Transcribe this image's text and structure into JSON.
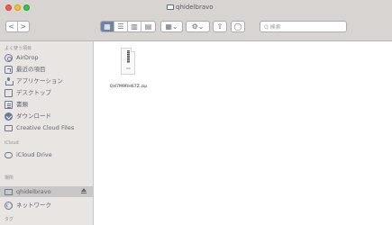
{
  "window": {
    "title": "qhidelbravo"
  },
  "toolbar": {
    "back": "<",
    "forward": ">",
    "view_icon": "▦",
    "list_icon": "☰",
    "column_icon": "▥",
    "gallery_icon": "▤",
    "arrange_icon": "▦",
    "action_icon": "⚙",
    "share_icon": "⇧",
    "tag_icon": "◯",
    "search_placeholder": "Q 検索"
  },
  "sidebar": {
    "favorites_label": "よく使う項目",
    "items": [
      {
        "label": "AirDrop",
        "icon": "airdrop-icon"
      },
      {
        "label": "最近の項目",
        "icon": "recent-icon"
      },
      {
        "label": "アプリケーション",
        "icon": "applications-icon"
      },
      {
        "label": "デスクトップ",
        "icon": "desktop-icon"
      },
      {
        "label": "書類",
        "icon": "documents-icon"
      },
      {
        "label": "ダウンロード",
        "icon": "download-icon"
      },
      {
        "label": "Creative Cloud Files",
        "icon": "folder-icon"
      }
    ],
    "icloud_label": "iCloud",
    "icloud_drive": "iCloud Drive",
    "locations_label": "場所",
    "device": "qhidelbravo",
    "network": "ネットワーク",
    "tags_label": "タグ"
  },
  "files": [
    {
      "name": "QH7M9RH67Z.zip",
      "icon": "zip-file-icon",
      "badge": "ZIP"
    }
  ]
}
